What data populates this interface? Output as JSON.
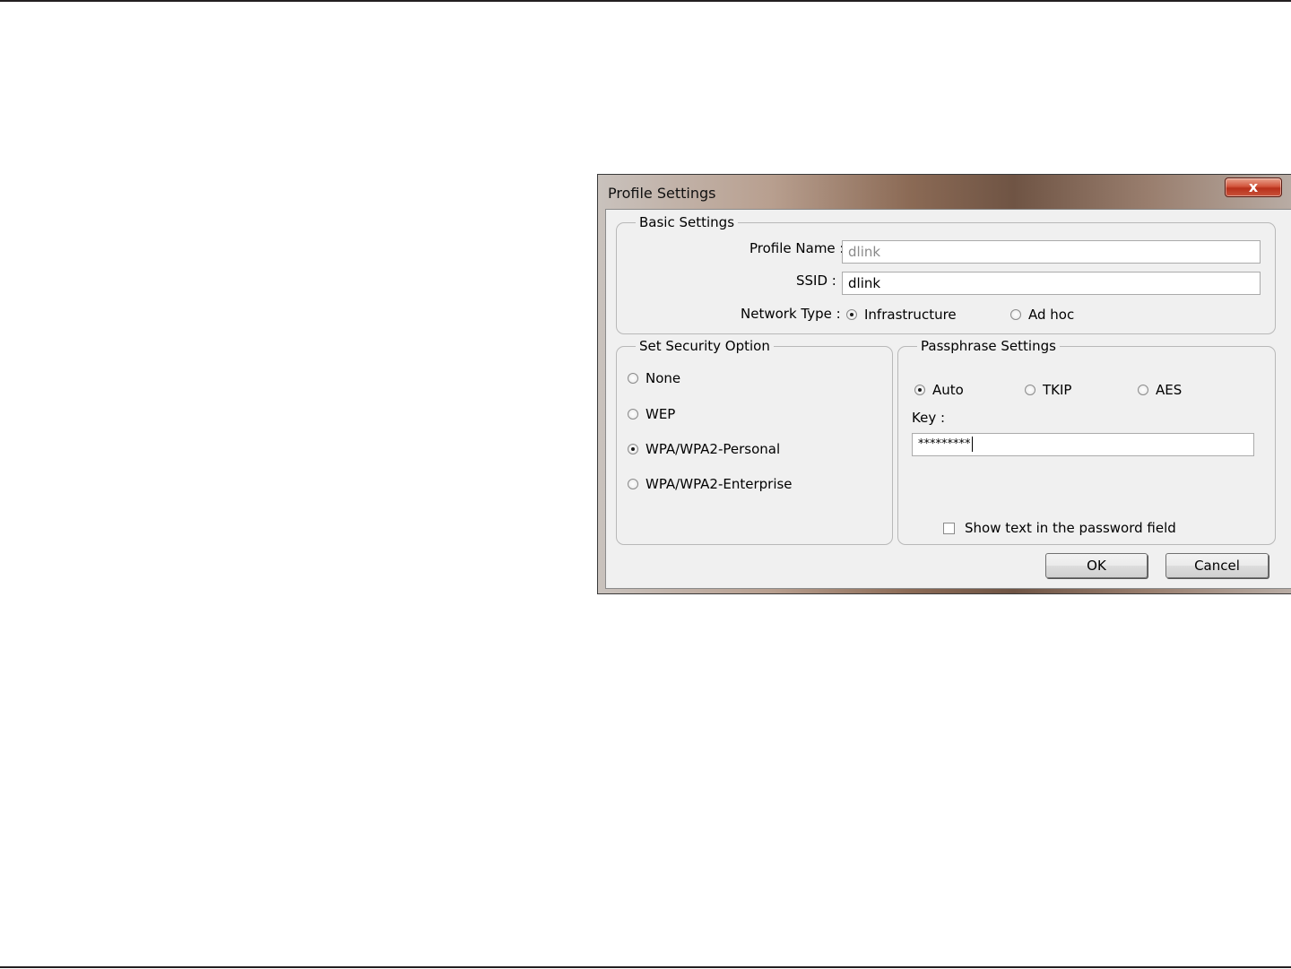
{
  "window": {
    "title": "Profile Settings",
    "close_glyph": "x"
  },
  "basic_settings": {
    "legend": "Basic Settings",
    "profile_name_label": "Profile Name :",
    "profile_name_value": "dlink",
    "ssid_label": "SSID :",
    "ssid_value": "dlink",
    "network_type_label": "Network Type :",
    "network_types": [
      {
        "label": "Infrastructure",
        "checked": true
      },
      {
        "label": "Ad hoc",
        "checked": false
      }
    ]
  },
  "security": {
    "legend": "Set Security Option",
    "options": [
      {
        "label": "None",
        "checked": false
      },
      {
        "label": "WEP",
        "checked": false
      },
      {
        "label": "WPA/WPA2-Personal",
        "checked": true
      },
      {
        "label": "WPA/WPA2-Enterprise",
        "checked": false
      }
    ]
  },
  "passphrase": {
    "legend": "Passphrase Settings",
    "ciphers": [
      {
        "label": "Auto",
        "checked": true
      },
      {
        "label": "TKIP",
        "checked": false
      },
      {
        "label": "AES",
        "checked": false
      }
    ],
    "key_label": "Key :",
    "key_value": "*********",
    "show_text_label": "Show text in the password field",
    "show_text_checked": false
  },
  "buttons": {
    "ok": "OK",
    "cancel": "Cancel"
  },
  "colors": {
    "close_button": "#c9533b",
    "dialog_bg": "#f0f0f0"
  }
}
